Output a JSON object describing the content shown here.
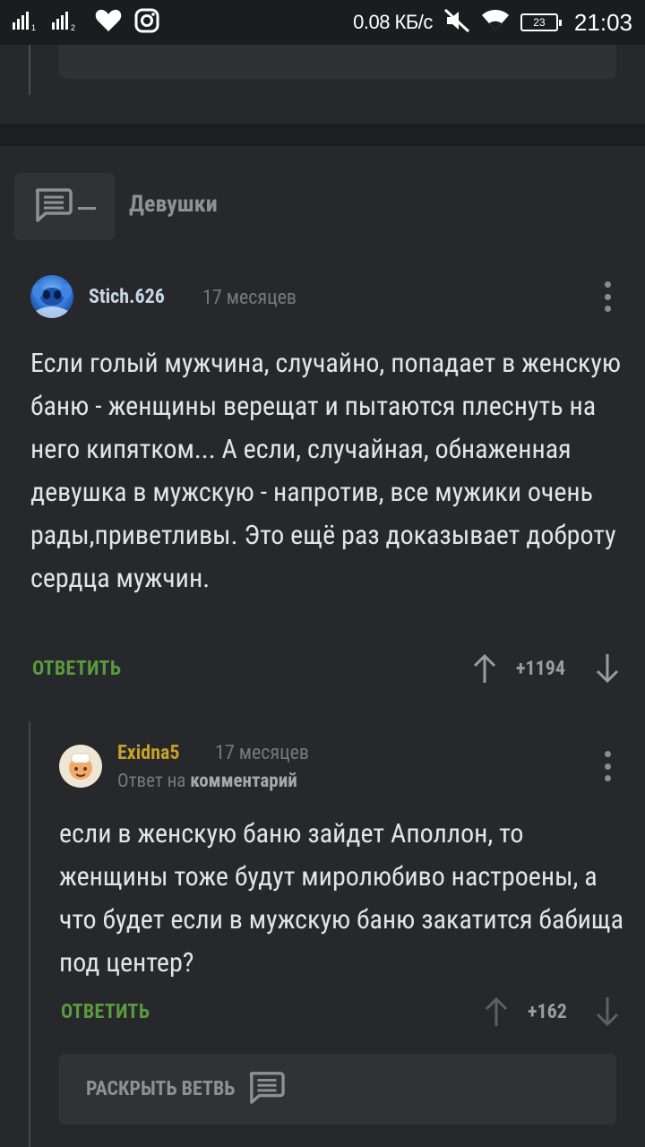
{
  "status_bar": {
    "sim1": "1",
    "sim2": "2",
    "net_speed": "0.08 КБ/с",
    "battery": "23",
    "time": "21:03"
  },
  "story": {
    "title": "Девушки"
  },
  "comments": [
    {
      "author": "Stich.626",
      "time": "17 месяцев",
      "text": "Если голый мужчина, случайно, попадает в женскую баню - женщины верещат и пытаются плеснуть на него кипятком... А если, случайная, обнаженная девушка в мужскую - напротив, все мужики очень рады,приветливы. Это ещё раз доказывает доброту сердца мужчин.",
      "reply_label": "ОТВЕТИТЬ",
      "rating": "+1194"
    },
    {
      "author": "Exidna5",
      "time": "17 месяцев",
      "reply_prefix": "Ответ на",
      "reply_target": "комментарий",
      "text": "если в женскую баню зайдет Аполлон, то женщины тоже будут миролюбиво настроены, а что будет если в мужскую баню закатится бабища под центер?",
      "reply_label": "ОТВЕТИТЬ",
      "rating": "+162"
    }
  ],
  "expand_branch": {
    "label": "РАСКРЫТЬ ВЕТВЬ"
  },
  "colors": {
    "background": "#26282c",
    "author1": "#c9d6e6",
    "author2": "#c6a028",
    "reply": "#5b9a3f"
  }
}
